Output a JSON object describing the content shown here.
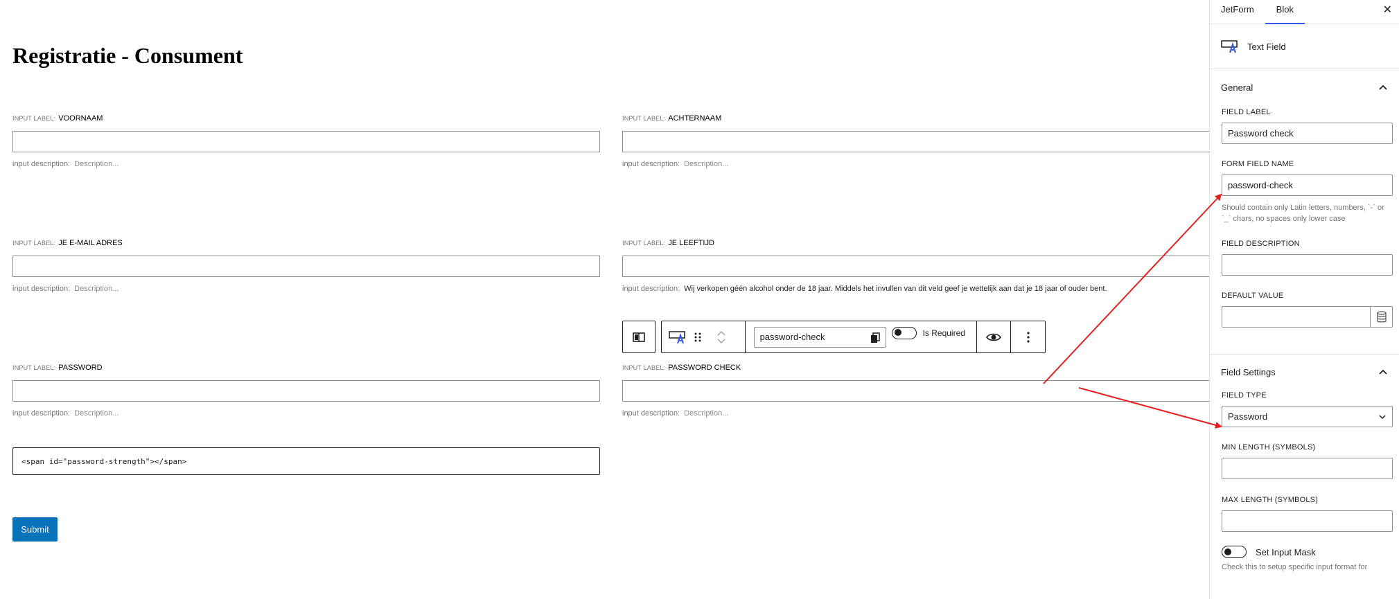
{
  "form": {
    "title": "Registratie - Consument",
    "label_prefix": "INPUT LABEL:",
    "desc_prefix": "input description:",
    "fields": [
      {
        "label": "VOORNAAM",
        "description": "Description..."
      },
      {
        "label": "ACHTERNAAM",
        "description": "Description..."
      },
      {
        "label": "JE E-MAIL ADRES",
        "description": "Description..."
      },
      {
        "label": "JE LEEFTIJD",
        "description": "Wij verkopen géén alcohol onder de 18 jaar. Middels het invullen van dit veld geef je wettelijk aan dat je 18 jaar of ouder bent."
      },
      {
        "label": "PASSWORD",
        "description": "Description..."
      },
      {
        "label": "PASSWORD CHECK",
        "description": "Description..."
      }
    ],
    "code": "<span id=\"password-strength\"></span>",
    "submit_label": "Submit"
  },
  "toolbar": {
    "field_name": "password-check",
    "required_label": "Is Required"
  },
  "sidebar": {
    "tabs": [
      "JetForm",
      "Blok"
    ],
    "active_tab": "Blok",
    "block_name": "Text Field",
    "general": {
      "title": "General",
      "field_label": {
        "label": "FIELD LABEL",
        "value": "Password check"
      },
      "form_field_name": {
        "label": "FORM FIELD NAME",
        "value": "password-check",
        "help": "Should contain only Latin letters, numbers, `-` or `_` chars, no spaces only lower case"
      },
      "field_description": {
        "label": "FIELD DESCRIPTION",
        "value": ""
      },
      "default_value": {
        "label": "DEFAULT VALUE",
        "value": ""
      }
    },
    "field_settings": {
      "title": "Field Settings",
      "field_type": {
        "label": "FIELD TYPE",
        "value": "Password"
      },
      "min_length": {
        "label": "MIN LENGTH (SYMBOLS)",
        "value": ""
      },
      "max_length": {
        "label": "MAX LENGTH (SYMBOLS)",
        "value": ""
      },
      "input_mask": {
        "label": "Set Input Mask",
        "help": "Check this to setup specific input format for"
      }
    }
  },
  "colors": {
    "accent": "#3858e9",
    "button": "#0a72b8",
    "annotation_arrow": "#e81f1f"
  }
}
